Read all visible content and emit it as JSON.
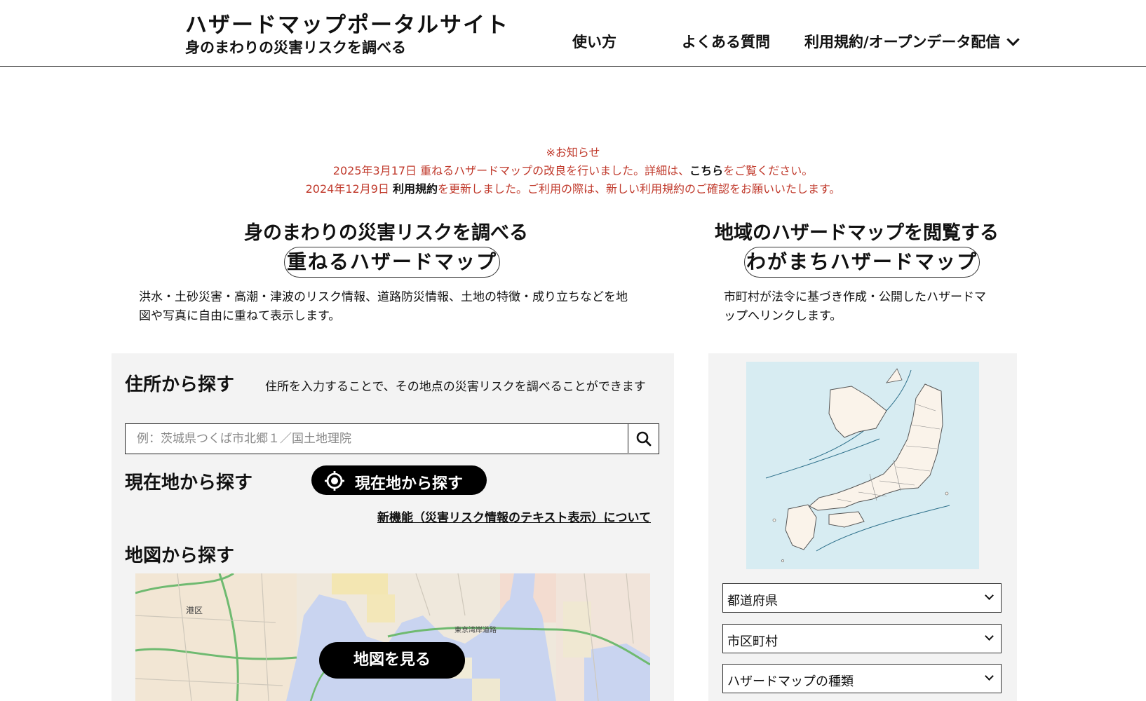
{
  "header": {
    "title": "ハザードマップポータルサイト",
    "subtitle": "身のまわりの災害リスクを調べる",
    "nav": {
      "howto": "使い方",
      "faq": "よくある質問",
      "terms": "利用規約/オープンデータ配信"
    }
  },
  "notice": {
    "heading": "※お知らせ",
    "line1_date": "2025年3月17日",
    "line1_text": "重ねるハザードマップの改良を行いました。詳細は、",
    "line1_link": "こちら",
    "line1_tail": "をご覧ください。",
    "line2_date": "2024年12月9日",
    "line2_link": "利用規約",
    "line2_text": "を更新しました。ご利用の際は、新しい利用規約のご確認をお願いいたします。"
  },
  "left": {
    "heading": "身のまわりの災害リスクを調べる",
    "pill": "重ねるハザードマップ",
    "desc_line1": "洪水・土砂災害・高潮・津波のリスク情報、道路防災情報、土地の特徴・成り立ちなどを地",
    "desc_line2": "図や写真に自由に重ねて表示します。",
    "address": {
      "heading": "住所から探す",
      "note": "住所を入力することで、その地点の災害リスクを調べることができます",
      "placeholder": "例：茨城県つくば市北郷１／国土地理院"
    },
    "current": {
      "heading": "現在地から探す",
      "button": "現在地から探す"
    },
    "new_feature": "新機能（災害リスク情報のテキスト表示）について",
    "map": {
      "heading": "地図から探す",
      "button": "地図を見る",
      "labels": [
        "港区",
        "東京湾岸道路"
      ]
    }
  },
  "right": {
    "heading": "地域のハザードマップを閲覧する",
    "pill": "わがまちハザードマップ",
    "desc_line1": "市町村が法令に基づき作成・公開したハザードマ",
    "desc_line2": "ップへリンクします。",
    "selects": {
      "prefecture": "都道府県",
      "city": "市区町村",
      "type": "ハザードマップの種類"
    }
  },
  "colors": {
    "notice_red": "#c0392b",
    "panel_bg": "#f3f3f3",
    "sea": "#d7ecf2",
    "land": "#faf3ea"
  }
}
